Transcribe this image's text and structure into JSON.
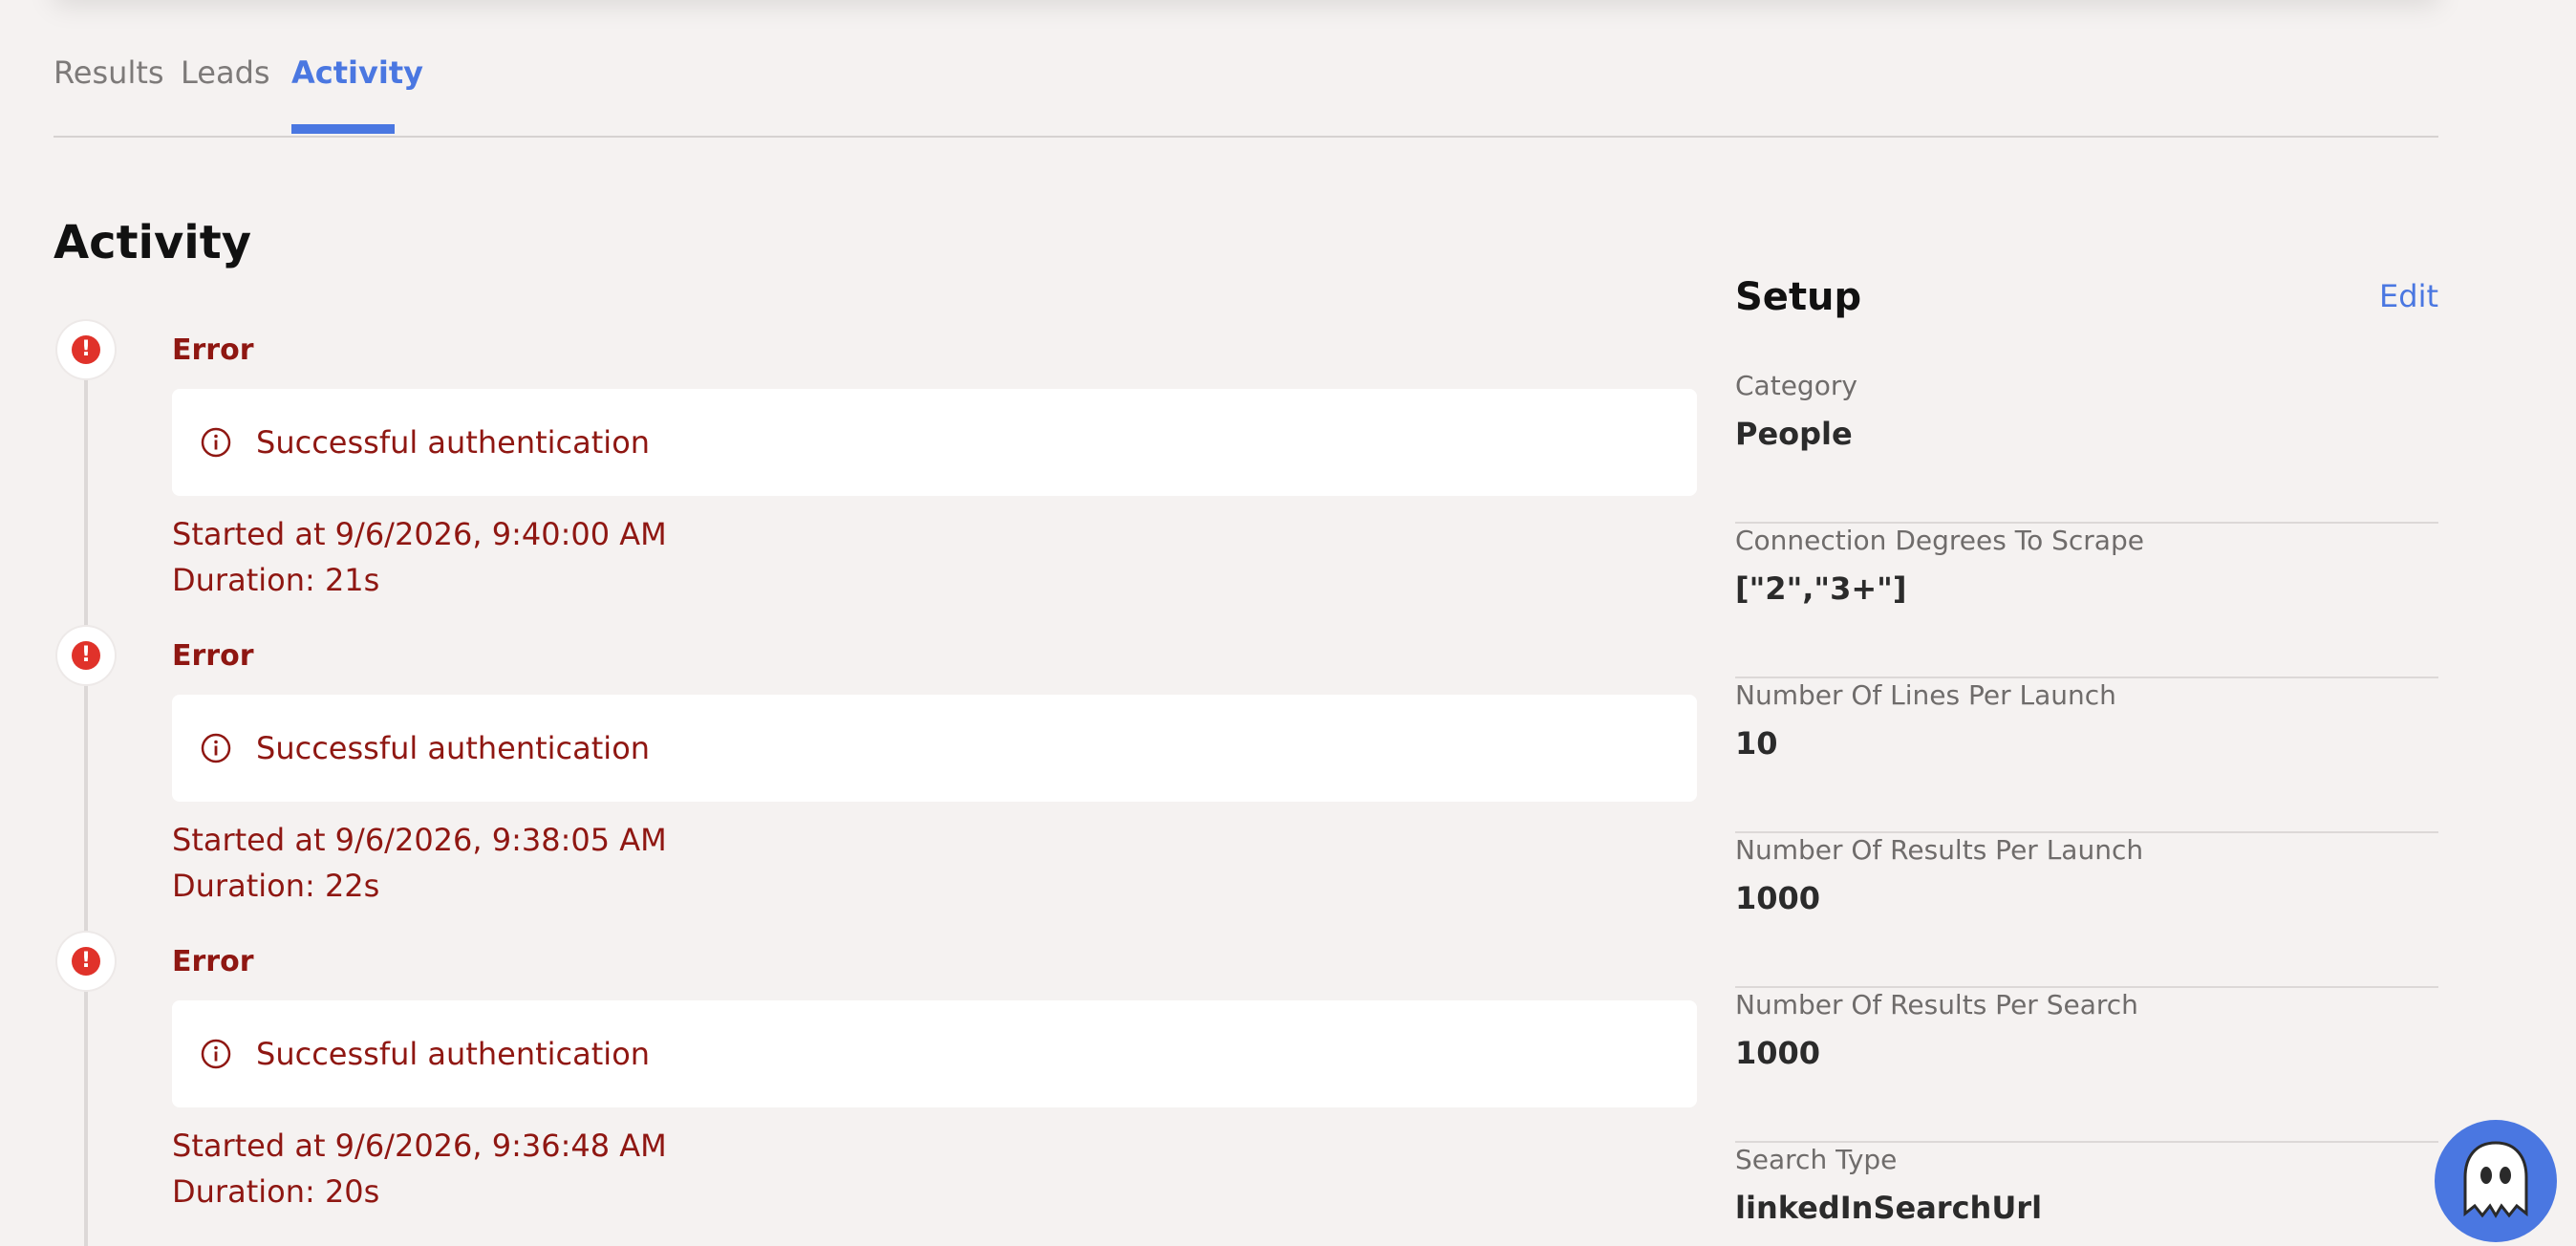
{
  "tabs": [
    {
      "label": "Results",
      "active": false
    },
    {
      "label": "Leads",
      "active": false
    },
    {
      "label": "Activity",
      "active": true
    }
  ],
  "activity": {
    "title": "Activity",
    "events": [
      {
        "status": "Error",
        "message": "Successful authentication",
        "started": "Started at 9/6/2026, 9:40:00 AM",
        "duration": "Duration: 21s"
      },
      {
        "status": "Error",
        "message": "Successful authentication",
        "started": "Started at 9/6/2026, 9:38:05 AM",
        "duration": "Duration: 22s"
      },
      {
        "status": "Error",
        "message": "Successful authentication",
        "started": "Started at 9/6/2026, 9:36:48 AM",
        "duration": "Duration: 20s"
      }
    ]
  },
  "setup": {
    "title": "Setup",
    "edit_label": "Edit",
    "items": [
      {
        "label": "Category",
        "value": "People"
      },
      {
        "label": "Connection Degrees To Scrape",
        "value": "[\"2\",\"3+\"]"
      },
      {
        "label": "Number Of Lines Per Launch",
        "value": "10"
      },
      {
        "label": "Number Of Results Per Launch",
        "value": "1000"
      },
      {
        "label": "Number Of Results Per Search",
        "value": "1000"
      },
      {
        "label": "Search Type",
        "value": "linkedInSearchUrl"
      }
    ]
  },
  "icons": {
    "error": "error-icon",
    "info": "info-icon",
    "chat": "ghost-icon"
  },
  "colors": {
    "accent": "#4a77e1",
    "error_text": "#8f1712",
    "error_dot": "#e0322a",
    "background": "#f5f2f1"
  }
}
